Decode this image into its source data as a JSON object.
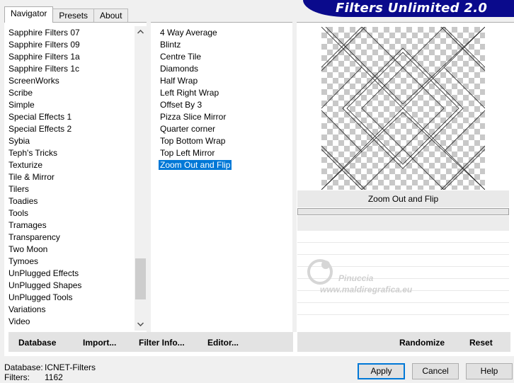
{
  "tabs": [
    "Navigator",
    "Presets",
    "About"
  ],
  "title": "Filters Unlimited 2.0",
  "categories": [
    "Sapphire Filters 07",
    "Sapphire Filters 09",
    "Sapphire Filters 1a",
    "Sapphire Filters 1c",
    "ScreenWorks",
    "Scribe",
    "Simple",
    "Special Effects 1",
    "Special Effects 2",
    "Sybia",
    "Teph's Tricks",
    "Texturize",
    "Tile & Mirror",
    "Tilers",
    "Toadies",
    "Tools",
    "Tramages",
    "Transparency",
    "Two Moon",
    "Tymoes",
    "UnPlugged Effects",
    "UnPlugged Shapes",
    "UnPlugged Tools",
    "Variations",
    "Video"
  ],
  "filters": [
    "4 Way Average",
    "Blintz",
    "Centre Tile",
    "Diamonds",
    "Half Wrap",
    "Left Right Wrap",
    "Offset By 3",
    "Pizza Slice Mirror",
    "Quarter corner",
    "Top Bottom Wrap",
    "Top Left Mirror",
    "Zoom Out and Flip"
  ],
  "selected_filter_index": 11,
  "preview": {
    "filter_name": "Zoom Out and Flip",
    "progress_fraction": 0
  },
  "watermark": {
    "name": "Pinuccia",
    "url": "www.maldiregrafica.eu"
  },
  "left_buttons": {
    "database": "Database",
    "import": "Import...",
    "filter_info": "Filter Info...",
    "editor": "Editor..."
  },
  "right_buttons": {
    "randomize": "Randomize",
    "reset": "Reset"
  },
  "footer": {
    "database_label": "Database:",
    "database_value": "ICNET-Filters",
    "filters_label": "Filters:",
    "filters_value": "1162"
  },
  "dialog_buttons": {
    "apply": "Apply",
    "cancel": "Cancel",
    "help": "Help"
  },
  "colors": {
    "banner": "#0a0a8c",
    "selection": "#0078d7"
  },
  "icons": {
    "scroll_up": "chevron-up-icon",
    "scroll_down": "chevron-down-icon"
  }
}
